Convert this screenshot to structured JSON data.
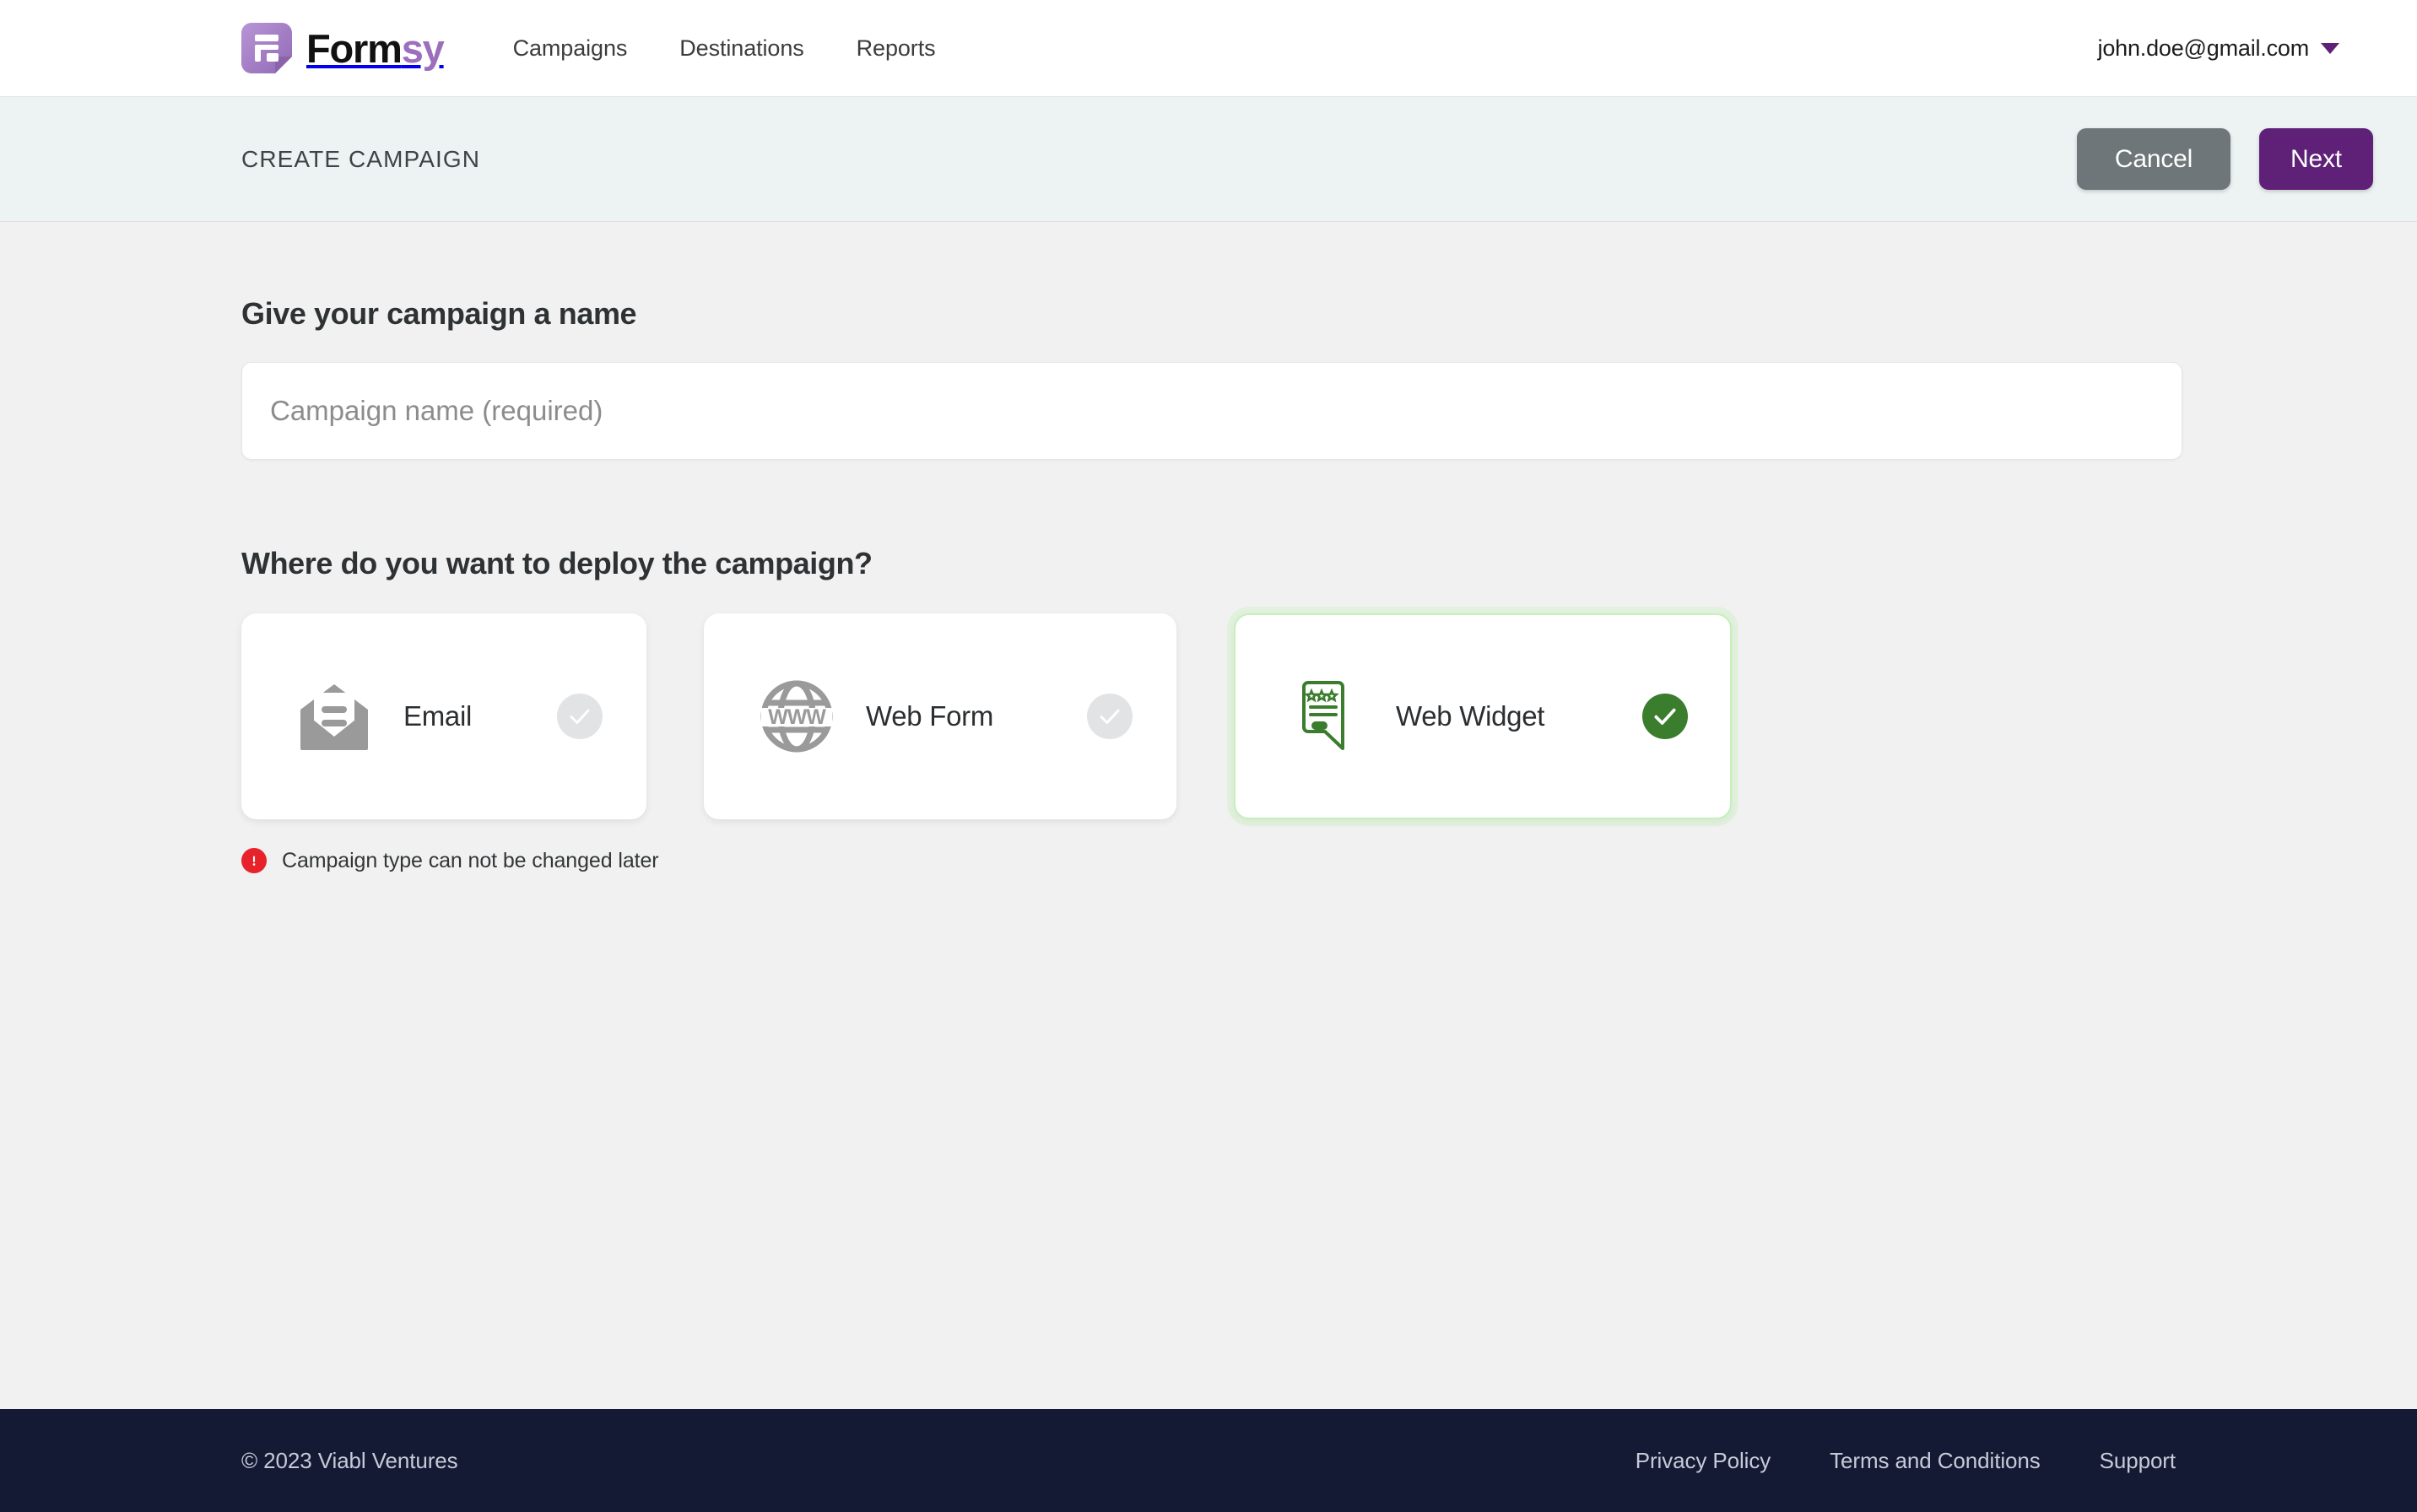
{
  "brand": {
    "name_part1": "Form",
    "name_part2": "sy",
    "logo_color": "#a077c4"
  },
  "nav": {
    "links": [
      {
        "label": "Campaigns"
      },
      {
        "label": "Destinations"
      },
      {
        "label": "Reports"
      }
    ],
    "account_email": "john.doe@gmail.com"
  },
  "subheader": {
    "title": "CREATE CAMPAIGN",
    "cancel_label": "Cancel",
    "next_label": "Next",
    "cancel_color": "#6e7679",
    "next_color": "#5f2178"
  },
  "main": {
    "name_heading": "Give your campaign a name",
    "name_placeholder": "Campaign name (required)",
    "name_value": "",
    "deploy_heading": "Where do you want to deploy the campaign?",
    "cards": [
      {
        "label": "Email",
        "icon": "envelope-icon",
        "selected": false
      },
      {
        "label": "Web Form",
        "icon": "globe-www-icon",
        "selected": false
      },
      {
        "label": "Web Widget",
        "icon": "widget-bubble-icon",
        "selected": true
      }
    ],
    "warning_text": "Campaign type can not be changed later",
    "warning_color": "#e8222b",
    "selected_color": "#3a7d2c"
  },
  "footer": {
    "copyright": "© 2023 Viabl Ventures",
    "links": [
      {
        "label": "Privacy Policy"
      },
      {
        "label": "Terms and Conditions"
      },
      {
        "label": "Support"
      }
    ]
  }
}
